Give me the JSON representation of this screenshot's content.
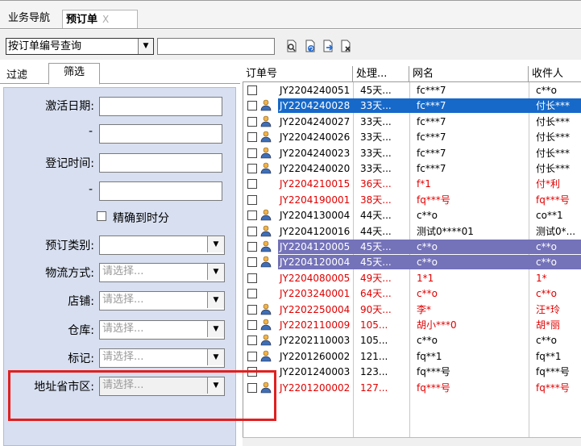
{
  "tabs": {
    "nav_label": "业务导航",
    "order_label": "预订单",
    "order_close": "X"
  },
  "toolbar": {
    "query_select_value": "按订单编号查询",
    "query_input_value": "",
    "icons": [
      "search-doc-icon",
      "refresh-doc-icon",
      "export-doc-icon",
      "delete-doc-icon"
    ]
  },
  "left_panel": {
    "tab_filter": "过滤",
    "tab_screen": "筛选",
    "activation_date_label": "激活日期:",
    "register_time_label": "登记时间:",
    "range_dash": "-",
    "precise_label": "精确到时分",
    "order_type_label": "预订类别:",
    "logistics_label": "物流方式:",
    "shop_label": "店铺:",
    "warehouse_label": "仓库:",
    "mark_label": "标记:",
    "region_label": "地址省市区:",
    "placeholder": "请选择..."
  },
  "grid": {
    "columns": [
      "订单号",
      "处理...",
      "网名",
      "收件人"
    ],
    "rows": [
      {
        "order": "JY2204240051",
        "proc": "45天...",
        "name": "fc***7",
        "recv": "c**o",
        "user": false,
        "style": "normal"
      },
      {
        "order": "JY2204240028",
        "proc": "33天...",
        "name": "fc***7",
        "recv": "付长***",
        "user": true,
        "style": "sel-blue"
      },
      {
        "order": "JY2204240027",
        "proc": "33天...",
        "name": "fc***7",
        "recv": "付长***",
        "user": true,
        "style": "normal"
      },
      {
        "order": "JY2204240026",
        "proc": "33天...",
        "name": "fc***7",
        "recv": "付长***",
        "user": true,
        "style": "normal"
      },
      {
        "order": "JY2204240023",
        "proc": "33天...",
        "name": "fc***7",
        "recv": "付长***",
        "user": true,
        "style": "normal"
      },
      {
        "order": "JY2204240020",
        "proc": "33天...",
        "name": "fc***7",
        "recv": "付长***",
        "user": true,
        "style": "normal"
      },
      {
        "order": "JY2204210015",
        "proc": "36天...",
        "name": "f*1",
        "recv": "付*利",
        "user": false,
        "style": "red"
      },
      {
        "order": "JY2204190001",
        "proc": "38天...",
        "name": "fq***号",
        "recv": "fq***号",
        "user": false,
        "style": "red"
      },
      {
        "order": "JY2204130004",
        "proc": "44天...",
        "name": "c**o",
        "recv": "co**1",
        "user": true,
        "style": "normal"
      },
      {
        "order": "JY2204120016",
        "proc": "44天...",
        "name": "测试0****01",
        "recv": "测试0*...",
        "user": true,
        "style": "normal"
      },
      {
        "order": "JY2204120005",
        "proc": "45天...",
        "name": "c**o",
        "recv": "c**o",
        "user": true,
        "style": "sel-purple"
      },
      {
        "order": "JY2204120004",
        "proc": "45天...",
        "name": "c**o",
        "recv": "c**o",
        "user": true,
        "style": "sel-purple"
      },
      {
        "order": "JY2204080005",
        "proc": "49天...",
        "name": "1*1",
        "recv": "1*",
        "user": false,
        "style": "red"
      },
      {
        "order": "JY2203240001",
        "proc": "64天...",
        "name": "c**o",
        "recv": "c**o",
        "user": false,
        "style": "red"
      },
      {
        "order": "JY2202250004",
        "proc": "90天...",
        "name": "李*",
        "recv": "汪*玲",
        "user": true,
        "style": "red"
      },
      {
        "order": "JY2202110009",
        "proc": "105...",
        "name": "胡小***0",
        "recv": "胡*丽",
        "user": true,
        "style": "red"
      },
      {
        "order": "JY2202110003",
        "proc": "105...",
        "name": "c**o",
        "recv": "c**o",
        "user": true,
        "style": "normal"
      },
      {
        "order": "JY2201260002",
        "proc": "121...",
        "name": "fq**1",
        "recv": "fq**1",
        "user": true,
        "style": "normal"
      },
      {
        "order": "JY2201240003",
        "proc": "123...",
        "name": "fq***号",
        "recv": "fq***号",
        "user": false,
        "style": "normal"
      },
      {
        "order": "JY2201200002",
        "proc": "127...",
        "name": "fq***号",
        "recv": "fq***号",
        "user": true,
        "style": "red"
      }
    ]
  },
  "colors": {
    "panel_bg": "#d7dff0",
    "select_blue": "#1669c9",
    "select_purple": "#7472b8",
    "red_text": "#e00000",
    "highlight": "#e02020"
  }
}
